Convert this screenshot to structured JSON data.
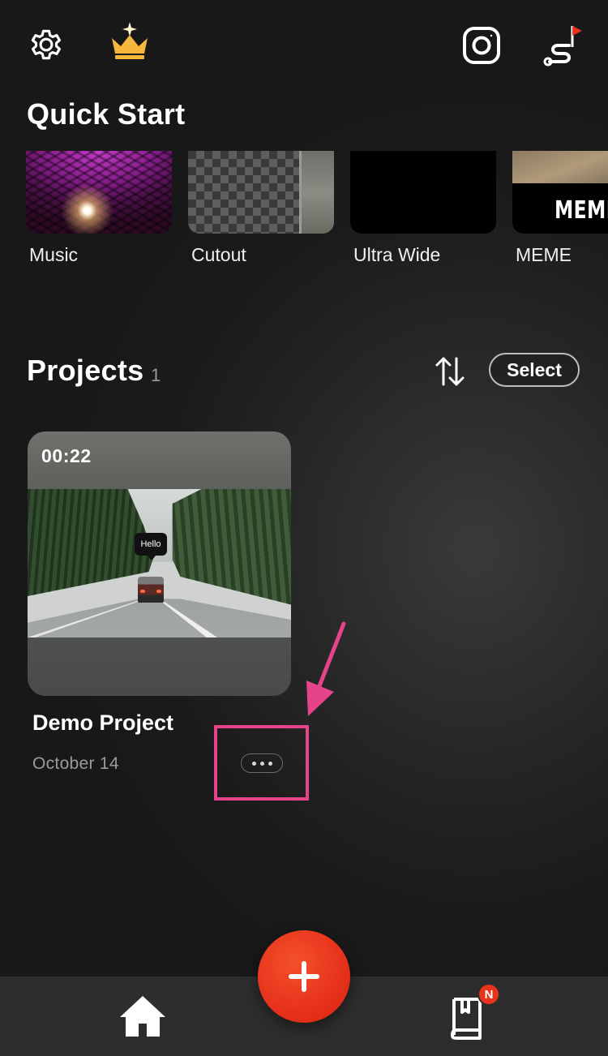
{
  "header": {
    "icons": [
      "gear-icon",
      "crown-icon",
      "instagram-icon",
      "roadmap-flag-icon"
    ]
  },
  "quick_start": {
    "title": "Quick Start",
    "items": [
      {
        "label": "Music",
        "icon": "music-thumbnail"
      },
      {
        "label": "Cutout",
        "icon": "cutout-thumbnail"
      },
      {
        "label": "Ultra Wide",
        "icon": "ultra-wide-thumbnail"
      },
      {
        "label": "MEME",
        "icon": "meme-thumbnail",
        "thumb_text": "MEME"
      }
    ]
  },
  "projects": {
    "title": "Projects",
    "count": "1",
    "select_label": "Select",
    "items": [
      {
        "duration": "00:22",
        "name": "Demo Project",
        "date": "October 14",
        "overlay_text": "Hello"
      }
    ]
  },
  "annotation": {
    "color": "#e6448a"
  },
  "bottom_nav": {
    "badge": "N",
    "accent": "#e8341c"
  }
}
